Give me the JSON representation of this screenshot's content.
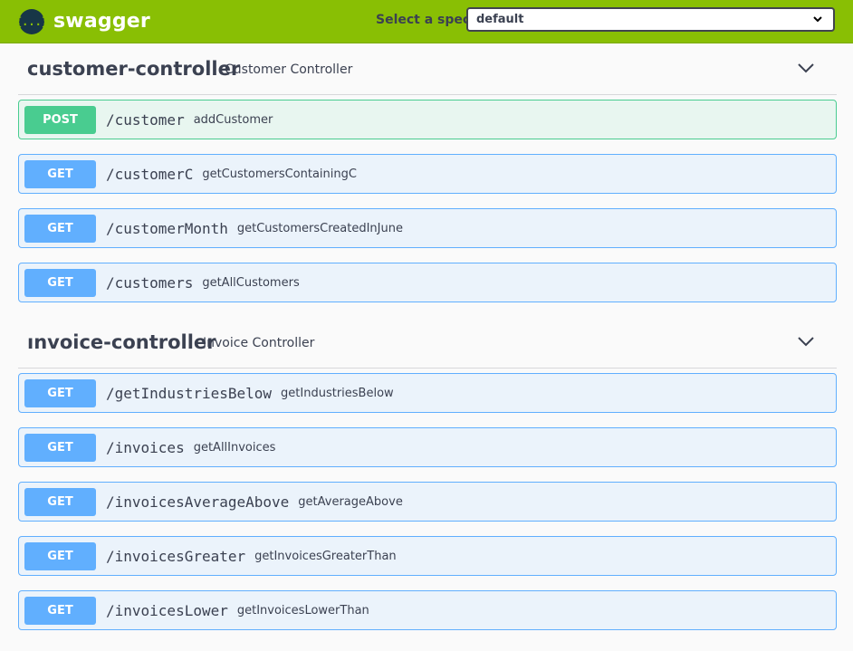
{
  "topbar": {
    "logo_icon_text": "{...}",
    "logo_text": "swagger",
    "spec_label": "Select a spec",
    "spec_value": "default",
    "brand_color": "#89bf04"
  },
  "sections": [
    {
      "name": "customer-controller",
      "description": "Customer Controller",
      "operations": [
        {
          "method": "POST",
          "path": "/customer",
          "summary": "addCustomer"
        },
        {
          "method": "GET",
          "path": "/customerC",
          "summary": "getCustomersContainingC"
        },
        {
          "method": "GET",
          "path": "/customerMonth",
          "summary": "getCustomersCreatedInJune"
        },
        {
          "method": "GET",
          "path": "/customers",
          "summary": "getAllCustomers"
        }
      ]
    },
    {
      "name": "ınvoice-controller",
      "description": "Invoice Controller",
      "operations": [
        {
          "method": "GET",
          "path": "/getIndustriesBelow",
          "summary": "getIndustriesBelow"
        },
        {
          "method": "GET",
          "path": "/invoices",
          "summary": "getAllInvoices"
        },
        {
          "method": "GET",
          "path": "/invoicesAverageAbove",
          "summary": "getAverageAbove"
        },
        {
          "method": "GET",
          "path": "/invoicesGreater",
          "summary": "getInvoicesGreaterThan"
        },
        {
          "method": "GET",
          "path": "/invoicesLower",
          "summary": "getInvoicesLowerThan"
        }
      ]
    }
  ],
  "colors": {
    "post": "#49cc90",
    "get": "#61affe"
  }
}
